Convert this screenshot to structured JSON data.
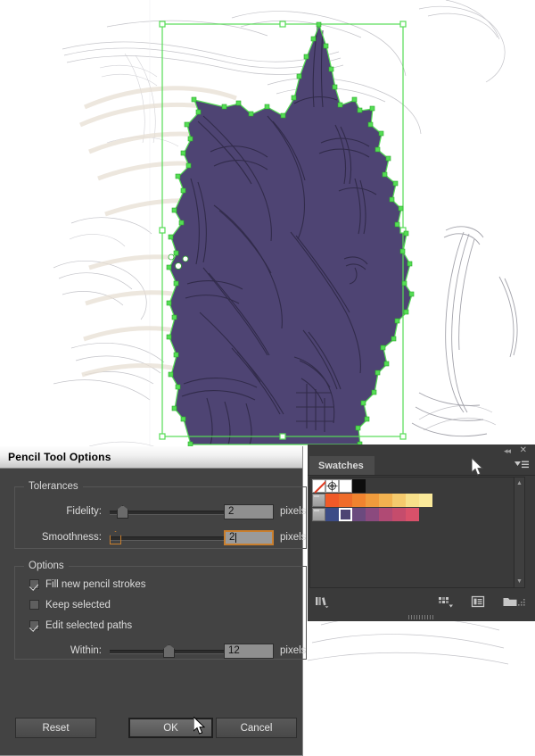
{
  "app": {
    "canvas_background": "#ffffff",
    "artwork_fill": "#4e4473",
    "selection_color": "#55dd55"
  },
  "dialog": {
    "title": "Pencil Tool Options",
    "groups": {
      "tolerances": {
        "legend": "Tolerances",
        "fields": [
          {
            "label": "Fidelity:",
            "value": "2",
            "unit": "pixels",
            "slider_pct": 8,
            "focused": false
          },
          {
            "label": "Smoothness:",
            "value": "2",
            "unit": "pixels",
            "slider_pct": 0,
            "focused": true
          }
        ]
      },
      "options": {
        "legend": "Options",
        "checkboxes": [
          {
            "label": "Fill new pencil strokes",
            "checked": true
          },
          {
            "label": "Keep selected",
            "checked": false
          },
          {
            "label": "Edit selected paths",
            "checked": true
          }
        ],
        "within": {
          "label": "Within:",
          "value": "12",
          "unit": "pixels",
          "slider_pct": 50
        }
      }
    },
    "buttons": {
      "reset": "Reset",
      "ok": "OK",
      "cancel": "Cancel"
    }
  },
  "swatches_panel": {
    "tab_label": "Swatches",
    "collapse_icon": "◂◂",
    "close_icon": "✕",
    "menu_icon": "panel-menu-icon",
    "rows": [
      {
        "kind": "specials",
        "items": [
          {
            "name": "none",
            "color": "#ffffff"
          },
          {
            "name": "registration",
            "color": "#ffffff"
          },
          {
            "name": "white",
            "color": "#ffffff"
          },
          {
            "name": "black",
            "color": "#0d0d0d"
          }
        ]
      },
      {
        "kind": "group",
        "folder": true,
        "items": [
          {
            "name": "orange-1",
            "color": "#f05a28"
          },
          {
            "name": "orange-2",
            "color": "#ef6c2a"
          },
          {
            "name": "orange-3",
            "color": "#f0832f"
          },
          {
            "name": "orange-4",
            "color": "#f09b3c"
          },
          {
            "name": "orange-5",
            "color": "#f2b250"
          },
          {
            "name": "orange-6",
            "color": "#f5ca6d"
          },
          {
            "name": "orange-7",
            "color": "#f7e08a"
          },
          {
            "name": "orange-8",
            "color": "#fae99a"
          }
        ]
      },
      {
        "kind": "group",
        "folder": true,
        "items": [
          {
            "name": "blue-1",
            "color": "#3c4c86"
          },
          {
            "name": "purple-1",
            "color": "#4e4473",
            "selected": true
          },
          {
            "name": "purple-2",
            "color": "#6b4a7e"
          },
          {
            "name": "magenta-1",
            "color": "#8b4a7e"
          },
          {
            "name": "rose-1",
            "color": "#b04a74"
          },
          {
            "name": "rose-2",
            "color": "#c54c6c"
          },
          {
            "name": "red-1",
            "color": "#d9516a"
          }
        ]
      }
    ],
    "bottom_icons": [
      "swatch-libraries-icon",
      "show-swatch-kinds-icon",
      "swatch-options-icon",
      "new-color-group-icon",
      "new-swatch-icon",
      "delete-swatch-icon"
    ],
    "scrollbar": {
      "up": "▲",
      "down": "▼"
    }
  }
}
